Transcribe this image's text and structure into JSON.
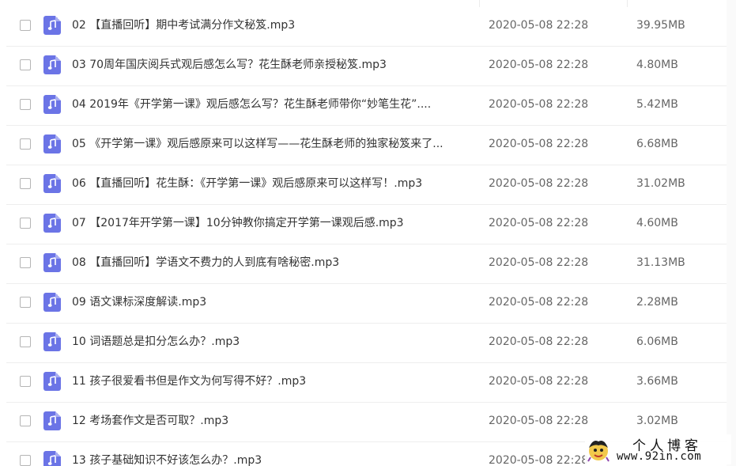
{
  "file_list": {
    "rows": [
      {
        "name": "02 【直播回听】期中考试满分作文秘笈.mp3",
        "date": "2020-05-08 22:28",
        "size": "39.95MB"
      },
      {
        "name": "03 70周年国庆阅兵式观后感怎么写？花生酥老师亲授秘笈.mp3",
        "date": "2020-05-08 22:28",
        "size": "4.80MB"
      },
      {
        "name": "04 2019年《开学第一课》观后感怎么写？花生酥老师带你“妙笔生花”....",
        "date": "2020-05-08 22:28",
        "size": "5.42MB"
      },
      {
        "name": "05 《开学第一课》观后感原来可以这样写——花生酥老师的独家秘笈来了...",
        "date": "2020-05-08 22:28",
        "size": "6.68MB"
      },
      {
        "name": "06 【直播回听】花生酥：《开学第一课》观后感原来可以这样写！.mp3",
        "date": "2020-05-08 22:28",
        "size": "31.02MB"
      },
      {
        "name": "07 【2017年开学第一课】10分钟教你搞定开学第一课观后感.mp3",
        "date": "2020-05-08 22:28",
        "size": "4.60MB"
      },
      {
        "name": "08 【直播回听】学语文不费力的人到底有啥秘密.mp3",
        "date": "2020-05-08 22:28",
        "size": "31.13MB"
      },
      {
        "name": "09 语文课标深度解读.mp3",
        "date": "2020-05-08 22:28",
        "size": "2.28MB"
      },
      {
        "name": "10 词语题总是扣分怎么办？.mp3",
        "date": "2020-05-08 22:28",
        "size": "6.06MB"
      },
      {
        "name": "11 孩子很爱看书但是作文为何写得不好？.mp3",
        "date": "2020-05-08 22:28",
        "size": "3.66MB"
      },
      {
        "name": "12 考场套作文是否可取？.mp3",
        "date": "2020-05-08 22:28",
        "size": "3.02MB"
      },
      {
        "name": "13 孩子基础知识不好该怎么办？.mp3",
        "date": "2020-05-08 22:28",
        "size": ""
      }
    ]
  },
  "icons": {
    "file_type": "audio-file-icon"
  },
  "colors": {
    "file_icon": "#6b74e6",
    "row_divider": "#eeeeee"
  },
  "watermark": {
    "title": "个人博客",
    "url": "www.92in.com"
  }
}
